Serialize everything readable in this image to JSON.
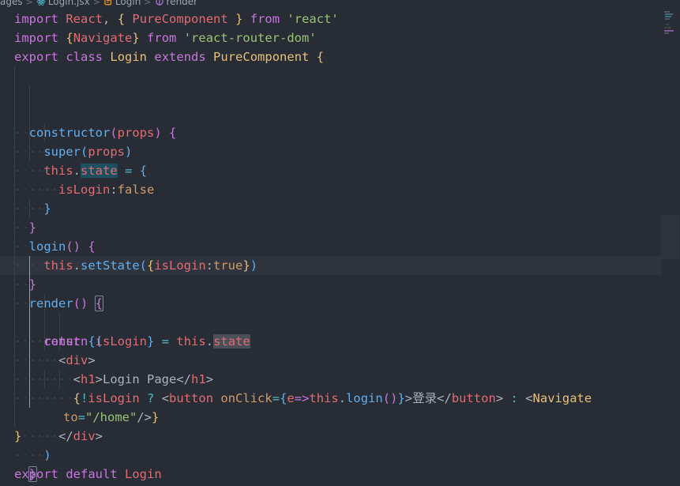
{
  "breadcrumb": {
    "items": [
      {
        "label": "ages",
        "icon": "folder-icon"
      },
      {
        "label": "Login.jsx",
        "icon": "react-icon"
      },
      {
        "label": "Login",
        "icon": "class-icon"
      },
      {
        "label": "render",
        "icon": "method-icon"
      }
    ],
    "separator": ">"
  },
  "editor": {
    "language": "jsx",
    "theme": "One Dark Pro",
    "background": "#282c34",
    "current_line_background": "#2f343e",
    "selection_highlight": "#1d4f5e",
    "occurrence_highlight": "#4a4f58",
    "indent_guide": "#3b4048",
    "active_indent_guide": "#c678dd",
    "colors": {
      "keyword": "#c678dd",
      "variable": "#e06c75",
      "function": "#61afef",
      "class": "#e5c07b",
      "string": "#98c379",
      "number": "#d19a66",
      "operator": "#56b6c2",
      "punctuation": "#abb2bf"
    },
    "lines": [
      "import React, { PureComponent } from 'react'",
      "import {Navigate} from 'react-router-dom'",
      "export class Login extends PureComponent {",
      "  constructor(props) {",
      "    super(props)",
      "    this.state = {",
      "      isLogin:false",
      "    }",
      "  }",
      "  login() {",
      "    this.setState({isLogin:true})",
      "  }",
      "  render() {",
      "    const {isLogin} = this.state",
      "    return (",
      "      <div>",
      "        <h1>Login Page</h1>",
      "        {!isLogin ? <button onClick={e=>this.login()}>登录</button> : <Navigate to=\"/home\"/>}",
      "      </div>",
      "    )",
      "  }",
      "}",
      "",
      "export default Login"
    ],
    "cursor_line_text": "    const {isLogin} = this.state",
    "highlighted_token": "state"
  },
  "tokens": {
    "import": "import",
    "export": "export",
    "default": "default",
    "classkw": "class",
    "extends": "extends",
    "from": "from",
    "const": "const",
    "return": "return",
    "react_name": "React",
    "pure_component": "PureComponent",
    "navigate": "Navigate",
    "login_name": "Login",
    "constructor": "constructor",
    "props": "props",
    "super": "super",
    "this": "this",
    "state": "state",
    "is_login": "isLogin",
    "false": "false",
    "true": "true",
    "login_fn": "login",
    "set_state": "setState",
    "render": "render",
    "str_react": "'react'",
    "str_router": "'react-router-dom'",
    "str_home": "\"/home\"",
    "div": "div",
    "h1": "h1",
    "button": "button",
    "login_page": "Login Page",
    "on_click": "onClick",
    "to_attr": "to",
    "cjk_login": "登录",
    "arrow": "e=>"
  }
}
